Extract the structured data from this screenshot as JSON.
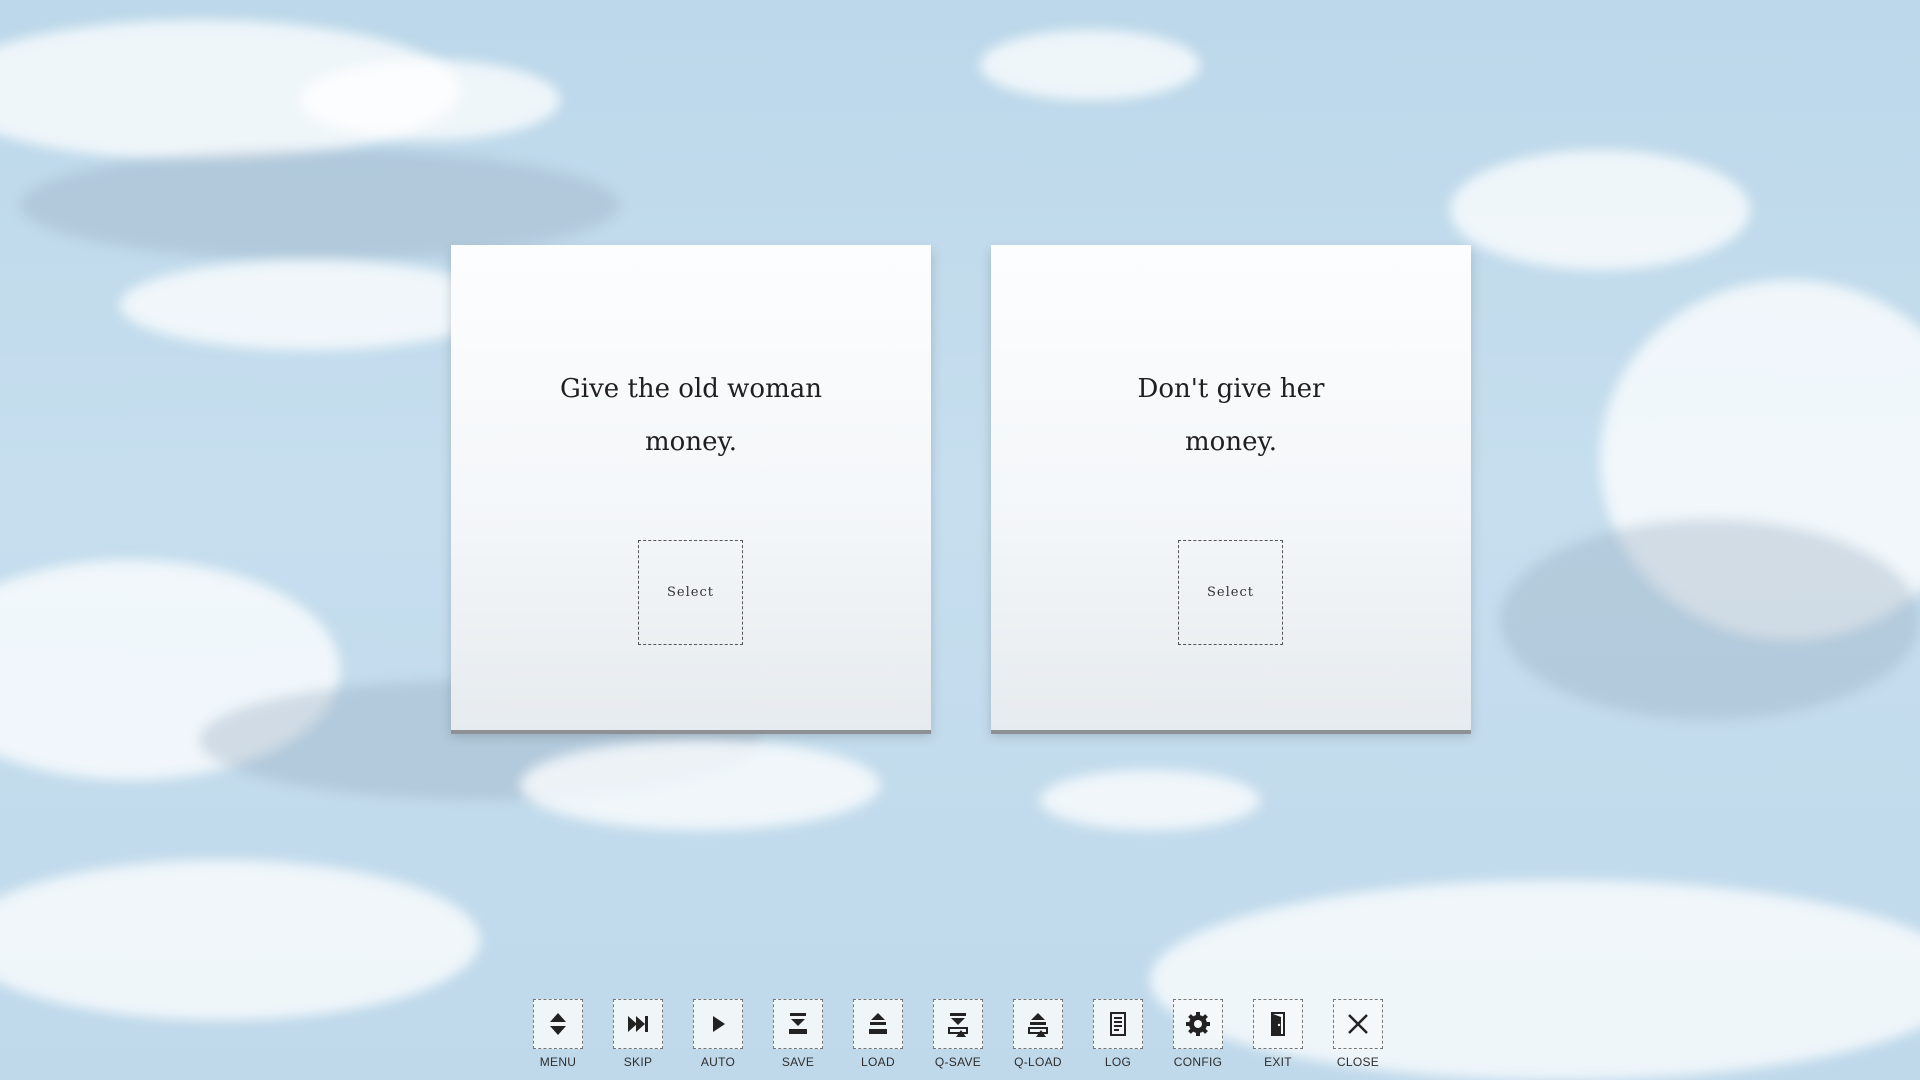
{
  "choices": [
    {
      "text_line1": "Give the old woman",
      "text_line2": "money.",
      "button_label": "Select"
    },
    {
      "text_line1": "Don't give her",
      "text_line2": "money.",
      "button_label": "Select"
    }
  ],
  "toolbar": {
    "items": [
      {
        "label": "MENU",
        "icon": "menu-updown-icon"
      },
      {
        "label": "SKIP",
        "icon": "skip-icon"
      },
      {
        "label": "AUTO",
        "icon": "play-icon"
      },
      {
        "label": "SAVE",
        "icon": "save-icon"
      },
      {
        "label": "LOAD",
        "icon": "load-icon"
      },
      {
        "label": "Q-SAVE",
        "icon": "quick-save-icon"
      },
      {
        "label": "Q-LOAD",
        "icon": "quick-load-icon"
      },
      {
        "label": "LOG",
        "icon": "log-icon"
      },
      {
        "label": "CONFIG",
        "icon": "gear-icon"
      },
      {
        "label": "EXIT",
        "icon": "exit-door-icon"
      },
      {
        "label": "CLOSE",
        "icon": "close-icon"
      }
    ]
  },
  "colors": {
    "sky": "#c3dbeb",
    "card": "#f7f9fb",
    "text": "#1f1f1f"
  }
}
